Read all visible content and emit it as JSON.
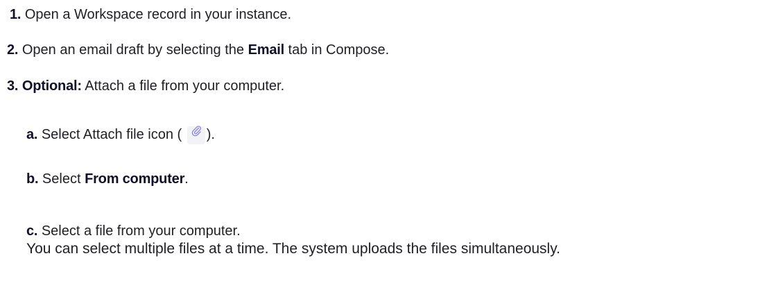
{
  "steps": [
    {
      "num": "1.",
      "text": " Open a Workspace record in your instance."
    },
    {
      "num": "2.",
      "pre": " Open an email draft by selecting the ",
      "bold": "Email",
      "post": " tab in Compose."
    },
    {
      "num": "3.",
      "bold": "Optional:",
      "post": "  Attach a file from your computer."
    }
  ],
  "substeps": {
    "a": {
      "letter": "a.",
      "pre": " Select Attach file icon (",
      "icon": "paperclip-icon",
      "post": ")."
    },
    "b": {
      "letter": "b.",
      "pre": " Select ",
      "bold": "From computer",
      "post": "."
    },
    "c": {
      "letter": "c.",
      "text": " Select a file from your computer.",
      "note": "You can select multiple files at a time. The system uploads the files simultaneously."
    }
  }
}
